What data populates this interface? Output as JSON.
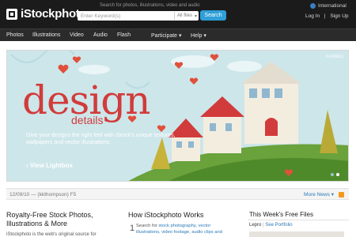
{
  "header": {
    "logo_text": "iStockphoto",
    "search_hint": "Search for photos, illustrations, video and audio",
    "search_placeholder": "Enter Keyword(s)",
    "files_filter": "All files",
    "search_button": "Search",
    "international": "International",
    "login": "Log In",
    "signup": "Sign Up",
    "separator": "|"
  },
  "nav": {
    "photos": "Photos",
    "illustrations": "Illustrations",
    "video": "Video",
    "audio": "Audio",
    "flash": "Flash",
    "participate": "Participate",
    "help": "Help"
  },
  "banner": {
    "image_id": "#1418613",
    "title": "design",
    "subtitle": "details",
    "promo_text": "Give your designs the right feel with iStock's unique textures, wallpapers and vector illustrations.",
    "cta": "View Lightbox"
  },
  "meta": {
    "date_line": "12/09/10 — (kkthompson) F5",
    "more_news": "More News"
  },
  "columns": {
    "royalty_title": "Royalty-Free Stock Photos, Illustrations & More",
    "royalty_text": "iStockphoto is the web's original source for",
    "how_title": "How iStockphoto Works",
    "step_number": "1",
    "step_intro": "Search for",
    "step_link": "stock photography, vector illustrations, video footage, audio clips and",
    "free_files_title": "This Week's Free Files",
    "free_author": "Lepro",
    "free_link": "See Portfolio"
  },
  "colors": {
    "header_bg": "#1b1b1b",
    "accent_blue": "#2e9fd8",
    "banner_red": "#d23b3b",
    "link_blue": "#2a7ab8"
  }
}
